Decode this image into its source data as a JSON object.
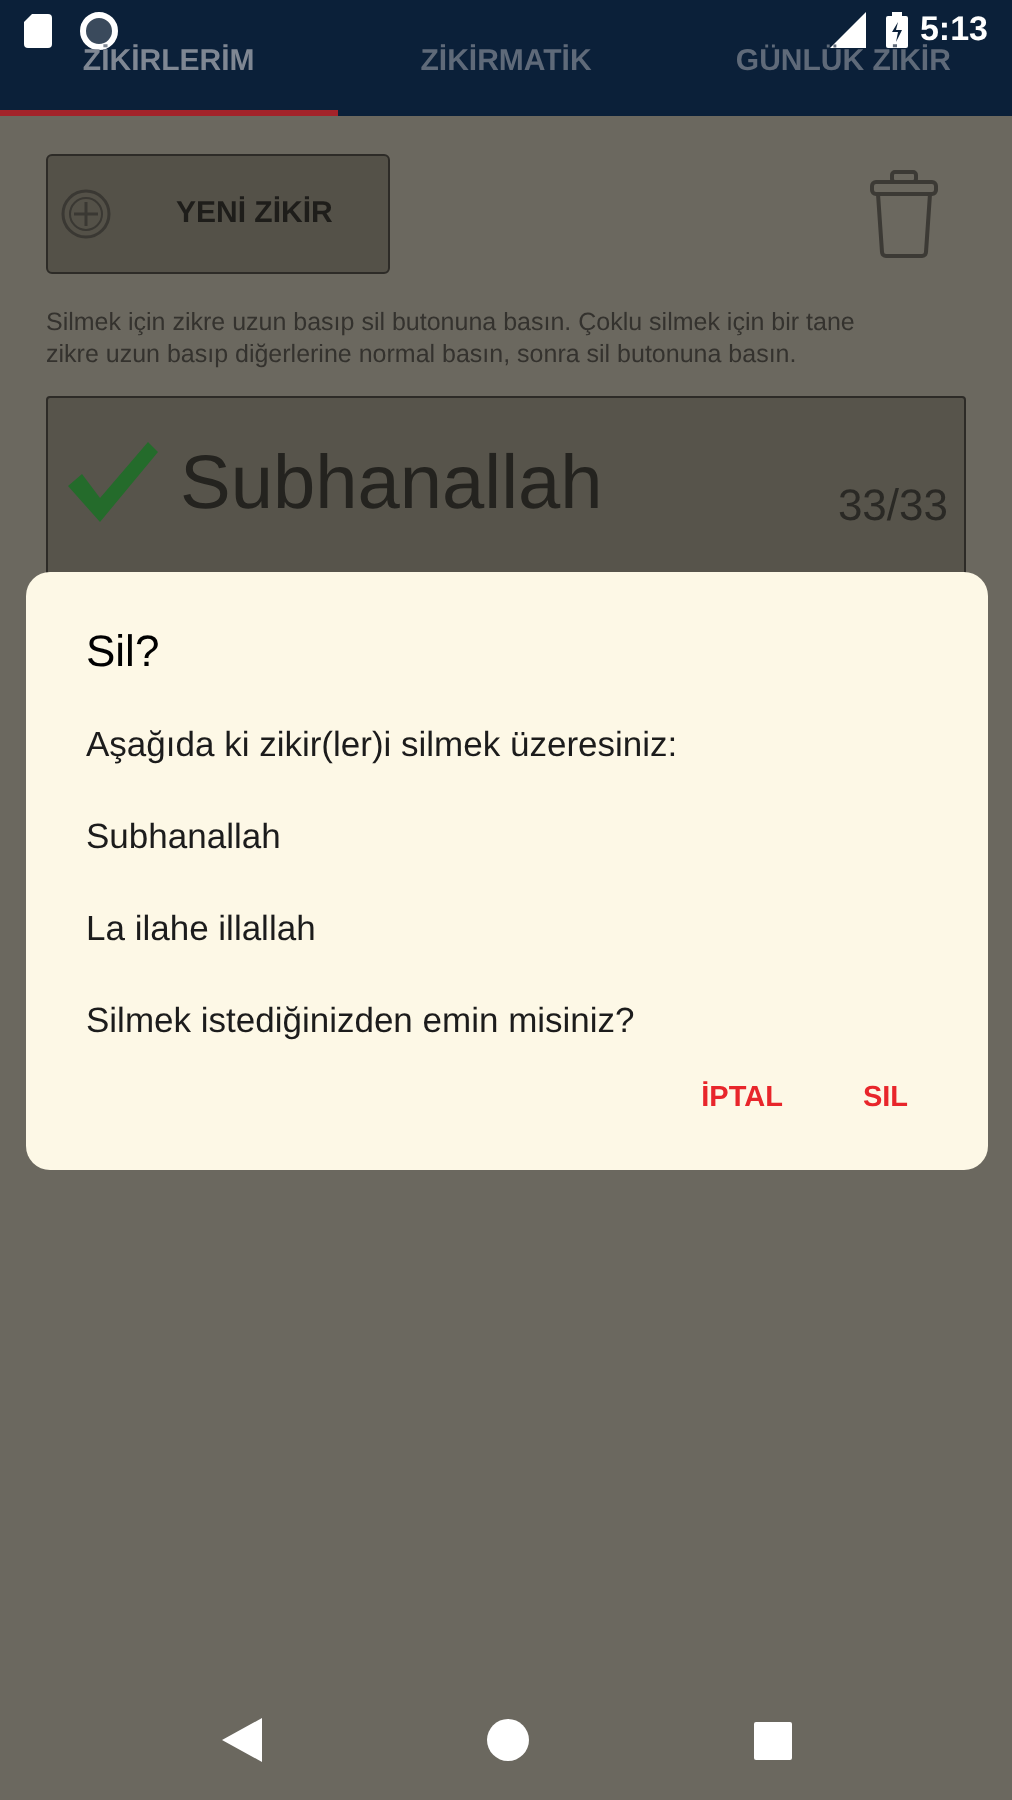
{
  "status_bar": {
    "time": "5:13"
  },
  "tabs": [
    {
      "label": "ZİKİRLERİM",
      "selected": true
    },
    {
      "label": "ZİKİRMATİK",
      "selected": false
    },
    {
      "label": "GÜNLÜK ZİKİR",
      "selected": false
    }
  ],
  "new_button": {
    "label": "YENİ ZİKİR"
  },
  "help_text": "Silmek için zikre uzun basıp sil butonuna basın. Çoklu silmek için bir tane zikre uzun basıp diğerlerine normal basın, sonra sil butonuna basın.",
  "zikirs": [
    {
      "name": "Subhanallah",
      "count": "33/33",
      "checked": true
    }
  ],
  "dialog": {
    "title": "Sil?",
    "lines": [
      "Aşağıda ki zikir(ler)i silmek üzeresiniz:",
      "Subhanallah",
      "La ilahe illallah",
      "Silmek istediğinizden emin misiniz?"
    ],
    "buttons": [
      "İPTAL",
      "SIL"
    ]
  }
}
